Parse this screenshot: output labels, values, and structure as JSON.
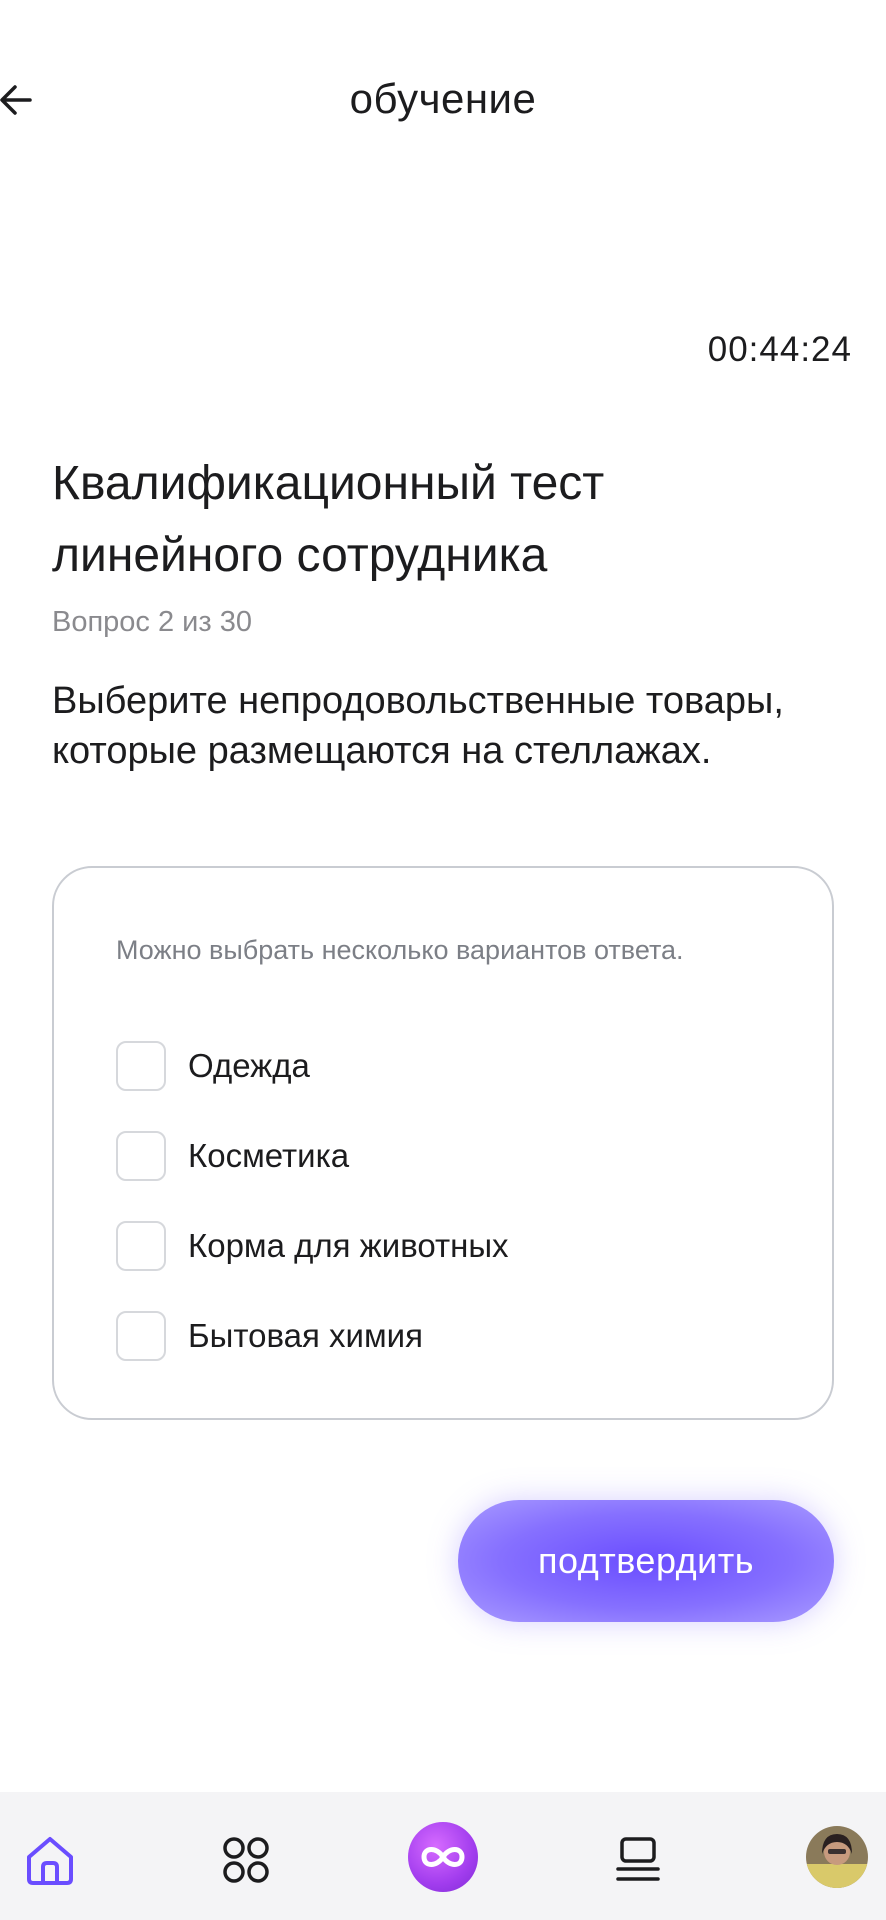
{
  "header": {
    "title": "обучение"
  },
  "timer": "00:44:24",
  "test": {
    "title": "Квалификационный тест линейного сотрудника",
    "counter": "Вопрос 2 из 30",
    "question": "Выберите непродовольственные товары, которые размещаются на стеллажах."
  },
  "options_card": {
    "hint": "Можно выбрать несколько вариантов ответа.",
    "options": [
      {
        "label": "Одежда",
        "checked": false
      },
      {
        "label": "Косметика",
        "checked": false
      },
      {
        "label": "Корма для животных",
        "checked": false
      },
      {
        "label": "Бытовая химия",
        "checked": false
      }
    ]
  },
  "submit_label": "подтвердить",
  "colors": {
    "accent": "#7b61ff",
    "nav_active": "#6a4dff",
    "center_button": "#a23dee"
  },
  "bottom_nav": {
    "items": [
      {
        "icon": "home-icon",
        "active": true
      },
      {
        "icon": "grid-icon",
        "active": false
      },
      {
        "icon": "infinity-icon",
        "active": false
      },
      {
        "icon": "list-icon",
        "active": false
      },
      {
        "icon": "avatar",
        "active": false
      }
    ]
  }
}
